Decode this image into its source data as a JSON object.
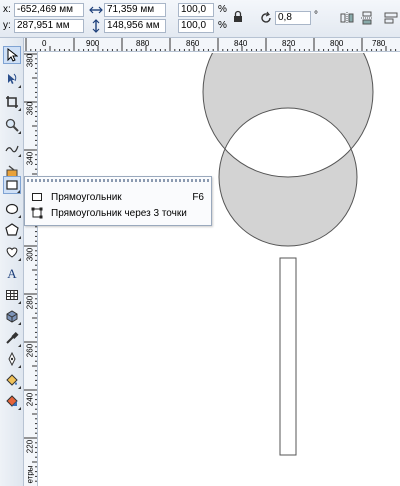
{
  "propbar": {
    "x_label": "x:",
    "y_label": "y:",
    "x_value": "-652,469 мм",
    "y_value": "287,951 мм",
    "width_value": "71,359 мм",
    "height_value": "148,956 мм",
    "scale_x": "100,0",
    "scale_y": "100,0",
    "percent": "%",
    "rotation": "0,8",
    "degree": "°"
  },
  "ruler_top": {
    "ticks": [
      {
        "label": "0"
      },
      {
        "label": "900"
      },
      {
        "label": "880"
      },
      {
        "label": "860"
      },
      {
        "label": "840"
      },
      {
        "label": "820"
      },
      {
        "label": "800"
      },
      {
        "label": "780"
      }
    ]
  },
  "ruler_left": {
    "ticks": [
      {
        "label": "380"
      },
      {
        "label": "360"
      },
      {
        "label": "340"
      },
      {
        "label": "320"
      },
      {
        "label": "300"
      },
      {
        "label": "280"
      },
      {
        "label": "260"
      },
      {
        "label": "240"
      },
      {
        "label": "220"
      }
    ],
    "unit": "етры"
  },
  "flyout": {
    "items": [
      {
        "label": "Прямоугольник",
        "shortcut": "F6"
      },
      {
        "label": "Прямоугольник через 3 точки",
        "shortcut": ""
      }
    ]
  },
  "toolbox": {
    "tools": [
      "pick-tool-icon",
      "shape-tool-icon",
      "crop-tool-icon",
      "zoom-tool-icon",
      "freehand-tool-icon",
      "smart-fill-tool-icon",
      "rectangle-tool-icon",
      "ellipse-tool-icon",
      "polygon-tool-icon",
      "basic-shapes-tool-icon",
      "text-tool-icon",
      "table-tool-icon",
      "extrude-tool-icon",
      "eyedropper-tool-icon",
      "outline-pen-tool-icon",
      "fill-tool-icon",
      "interactive-fill-tool-icon"
    ]
  },
  "colors": {
    "ring_fill": "#d3d3d3",
    "ring_stroke": "#555555",
    "accent": "#3c6fb6"
  }
}
